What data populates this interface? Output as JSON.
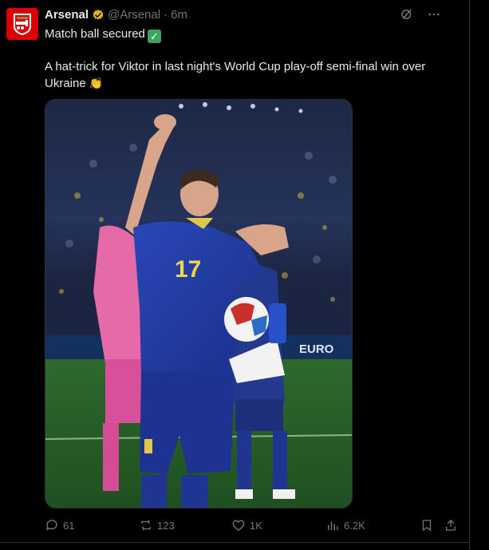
{
  "account": {
    "name": "Arsenal",
    "handle": "@Arsenal",
    "separator": "·",
    "time": "6m",
    "brand_color": "#db0007"
  },
  "tweet": {
    "line1": "Match ball secured",
    "line1_emoji": "✓",
    "line2": "A hat-trick for Viktor in last night's World Cup play-off semi-final win over Ukraine",
    "line2_emoji": "👏"
  },
  "photo": {
    "shirt_number": "17",
    "board_text": "EURO"
  },
  "actions": {
    "replies": "61",
    "reposts": "123",
    "likes": "1K",
    "views": "6.2K"
  },
  "colors": {
    "accent_text": "#e7e9ea",
    "muted": "#71767b",
    "verified_gold": "#e2b719"
  }
}
